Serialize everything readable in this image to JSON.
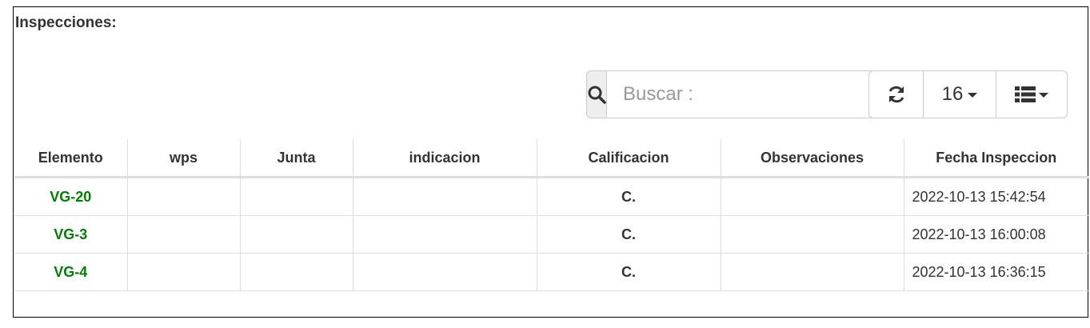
{
  "panel": {
    "title": "Inspecciones:"
  },
  "toolbar": {
    "search_icon": "search-icon",
    "search_placeholder": "Buscar :",
    "search_value": "",
    "refresh_icon": "refresh-icon",
    "page_size": "16",
    "columns_icon": "list-icon"
  },
  "table": {
    "headers": [
      "Elemento",
      "wps",
      "Junta",
      "indicacion",
      "Calificacion",
      "Observaciones",
      "Fecha Inspeccion"
    ],
    "rows": [
      {
        "elemento": "VG-20",
        "wps": "",
        "junta": "",
        "indicacion": "",
        "calificacion": "C.",
        "observaciones": "",
        "fecha": "2022-10-13 15:42:54"
      },
      {
        "elemento": "VG-3",
        "wps": "",
        "junta": "",
        "indicacion": "",
        "calificacion": "C.",
        "observaciones": "",
        "fecha": "2022-10-13 16:00:08"
      },
      {
        "elemento": "VG-4",
        "wps": "",
        "junta": "",
        "indicacion": "",
        "calificacion": "C.",
        "observaciones": "",
        "fecha": "2022-10-13 16:36:15"
      }
    ]
  },
  "colors": {
    "link_green": "#008000",
    "border": "#dddddd",
    "text": "#333333"
  }
}
